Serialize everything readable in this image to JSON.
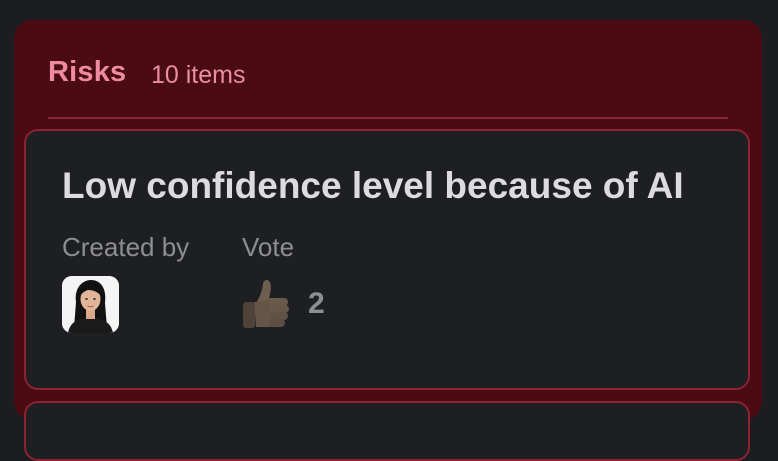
{
  "panel": {
    "title": "Risks",
    "count": "10 items",
    "accent_color": "#f08aa0",
    "background_color": "#4a0b12"
  },
  "card": {
    "title": "Low confidence level because of AI",
    "created_by_label": "Created by",
    "vote_label": "Vote",
    "vote_icon": "thumbs-up-icon",
    "vote_count": "2"
  }
}
